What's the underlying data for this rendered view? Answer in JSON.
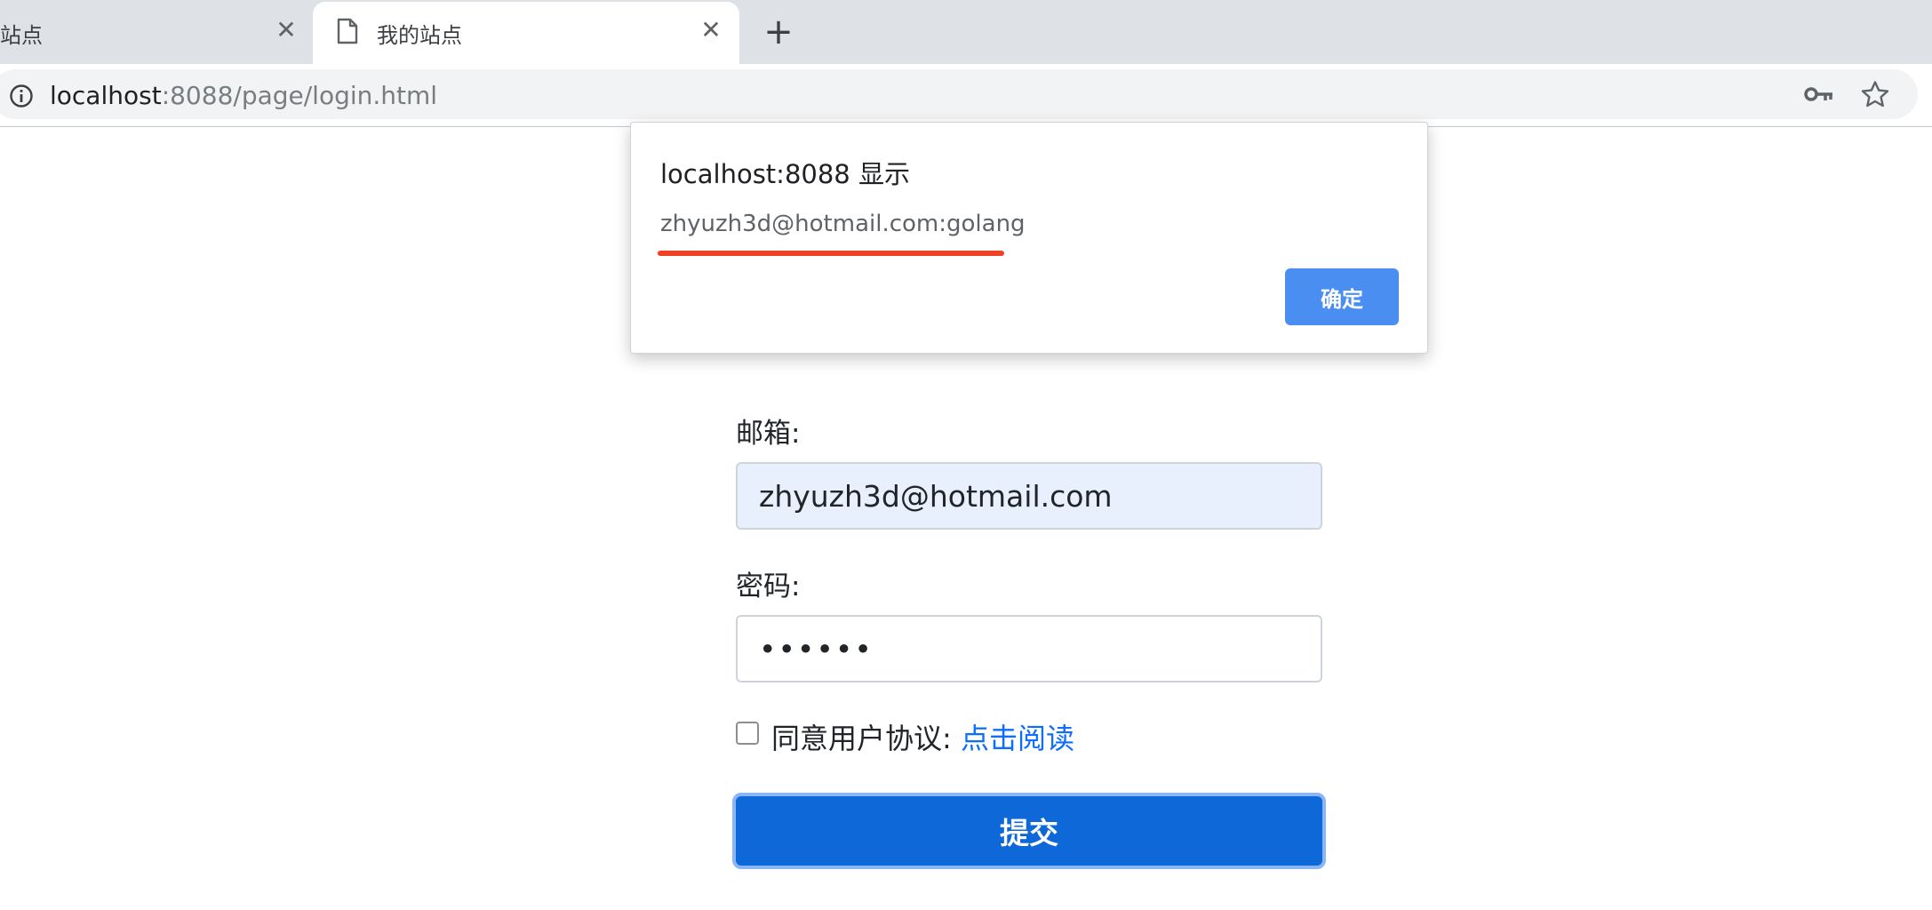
{
  "browser": {
    "tabs": [
      {
        "title": "站点",
        "close_icon": "close-icon"
      },
      {
        "title": "我的站点",
        "icon": "page-icon",
        "close_icon": "close-icon",
        "active": true
      }
    ],
    "new_tab_icon": "plus-icon",
    "address": {
      "info_icon": "info-icon",
      "host": "localhost",
      "rest": ":8088/page/login.html",
      "key_icon": "key-icon",
      "star_icon": "star-icon"
    }
  },
  "alert": {
    "title": "localhost:8088 显示",
    "message": "zhyuzh3d@hotmail.com:golang",
    "ok_label": "确定",
    "highlight_color": "#ef4125"
  },
  "form": {
    "email_label": "邮箱:",
    "email_value": "zhyuzh3d@hotmail.com",
    "password_label": "密码:",
    "password_value": "••••••",
    "agree_text": "同意用户协议: ",
    "agree_link": "点击阅读",
    "agree_checked": false,
    "submit_label": "提交"
  },
  "colors": {
    "primary": "#0f68d8",
    "link": "#0d6efd",
    "alert_button": "#4b8ef1"
  }
}
